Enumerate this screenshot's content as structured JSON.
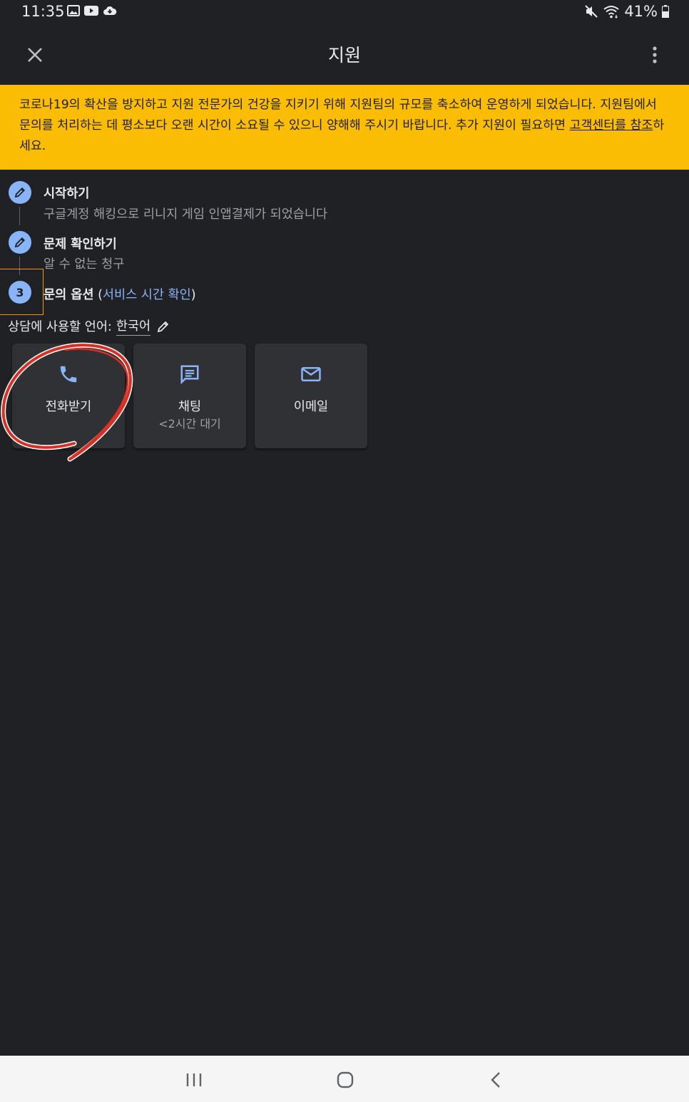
{
  "status_bar": {
    "time": "11:35",
    "battery": "41%",
    "icons": [
      "gallery-icon",
      "youtube-icon",
      "cloud-icon",
      "mute-icon",
      "wifi-icon",
      "battery-icon"
    ]
  },
  "app_bar": {
    "title": "지원",
    "close_icon": "close-icon",
    "more_icon": "more-vert-icon"
  },
  "banner": {
    "text_before": "코로나19의 확산을 방지하고 지원 전문가의 건강을 지키기 위해 지원팀의 규모를 축소하여 운영하게 되었습니다. 지원팀에서 문의를 처리하는 데 평소보다 오랜 시간이 소요될 수 있으니 양해해 주시기 바랍니다. 추가 지원이 필요하면 ",
    "link_text": "고객센터를 참조",
    "text_after": "하세요.",
    "color": "#fbbc04"
  },
  "steps": [
    {
      "title": "시작하기",
      "subtitle": "구글계정 해킹으로 리니지 게임  인앱결제가 되었습니다",
      "icon": "edit-icon"
    },
    {
      "title": "문제 확인하기",
      "subtitle": "알 수 없는 청구",
      "icon": "edit-icon"
    },
    {
      "number": "3",
      "title": "문의 옵션",
      "paren_open": " (",
      "link": "서비스 시간 확인",
      "paren_close": ")"
    }
  ],
  "language": {
    "label": "상담에 사용할 언어:",
    "value": "한국어"
  },
  "contact_options": [
    {
      "label": "전화받기",
      "icon": "phone-icon"
    },
    {
      "label": "채팅",
      "sublabel": "<2시간 대기",
      "icon": "chat-icon"
    },
    {
      "label": "이메일",
      "icon": "email-icon"
    }
  ],
  "colors": {
    "background": "#202124",
    "accent": "#8ab4f8",
    "card": "#303134",
    "annotation": "#d93025"
  }
}
